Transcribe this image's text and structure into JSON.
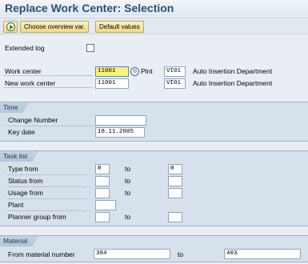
{
  "title": "Replace Work Center: Selection",
  "toolbar": {
    "execute_icon": "execute-icon",
    "choose_overview": "Choose overview var.",
    "default_values": "Default values"
  },
  "extended_log": {
    "label": "Extended log",
    "checked": false
  },
  "work_center": {
    "label": "Work center",
    "value": "11001",
    "plant_label": "Plnt",
    "plant_value": "VI01",
    "description": "Auto Insertion Department"
  },
  "new_work_center": {
    "label": "New work center",
    "value": "11001",
    "plant_value": "VI01",
    "description": "Auto Insertion Department"
  },
  "time": {
    "title": "Time",
    "change_number_label": "Change Number",
    "change_number_value": "",
    "key_date_label": "Key date",
    "key_date_value": "18.11.2005"
  },
  "task_list": {
    "title": "Task list",
    "to": "to",
    "type_from_label": "Type from",
    "type_from_value": "R",
    "type_to_value": "R",
    "status_from_label": "Status from",
    "usage_from_label": "Usage from",
    "plant_label": "Plant",
    "planner_group_label": "Planner group from"
  },
  "material": {
    "title": "Material",
    "from_label": "From material number",
    "from_value": "384",
    "to": "to",
    "to_value": "403"
  }
}
